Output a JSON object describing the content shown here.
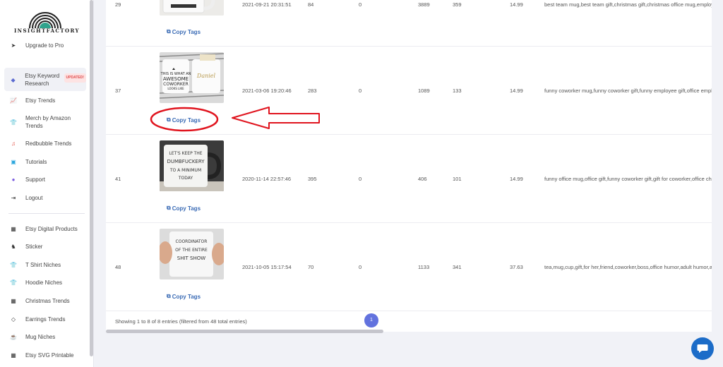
{
  "sidebar": {
    "logo_text": "INSIGHTFACTORY",
    "items": [
      {
        "label": "Upgrade to Pro",
        "icon": "paper-plane-icon",
        "glyph": "➤"
      },
      {
        "label": "Etsy Keyword Research",
        "badge": "UPDATED!",
        "icon": "tag-icon",
        "glyph": "◆"
      },
      {
        "label": "Etsy Trends",
        "icon": "line-chart-icon",
        "glyph": "📈"
      },
      {
        "label": "Merch by Amazon Trends",
        "icon": "tshirt-icon",
        "glyph": "👕"
      },
      {
        "label": "Redbubble Trends",
        "icon": "music-icon",
        "glyph": "♫"
      },
      {
        "label": "Tutorials",
        "icon": "tv-icon",
        "glyph": "▣"
      },
      {
        "label": "Support",
        "icon": "chat-icon",
        "glyph": "●"
      },
      {
        "label": "Logout",
        "icon": "logout-icon",
        "glyph": "⇥"
      },
      {
        "label": "Etsy Digital Products",
        "icon": "qr-icon",
        "glyph": "▦"
      },
      {
        "label": "Sticker",
        "icon": "horse-icon",
        "glyph": "♞"
      },
      {
        "label": "T Shirt Niches",
        "icon": "tshirt-icon",
        "glyph": "👕"
      },
      {
        "label": "Hoodie Niches",
        "icon": "hoodie-icon",
        "glyph": "👕"
      },
      {
        "label": "Christmas Trends",
        "icon": "qr-icon",
        "glyph": "▦"
      },
      {
        "label": "Earrings Trends",
        "icon": "diamond-icon",
        "glyph": "◇"
      },
      {
        "label": "Mug Niches",
        "icon": "mug-icon",
        "glyph": "☕"
      },
      {
        "label": "Etsy SVG Printable",
        "icon": "qr-icon",
        "glyph": "▦"
      }
    ]
  },
  "table": {
    "copy_label": "Copy Tags",
    "rows": [
      {
        "id": "29",
        "date": "2021-09-21 20:31:51",
        "c1": "84",
        "c2": "0",
        "c3": "3889",
        "c4": "359",
        "price": "14.99",
        "tags": "best team mug,best team gift,christmas gift,christmas office mug,employee gift,"
      },
      {
        "id": "37",
        "date": "2021-03-06 19:20:46",
        "c1": "283",
        "c2": "0",
        "c3": "1089",
        "c4": "133",
        "price": "14.99",
        "tags": "funny coworker mug,funny coworker gift,funny employee gift,office employee gift",
        "mug_text": "THIS IS WHAT AN AWESOME COWORKER LOOKS LIKE",
        "name_text": "Daniel"
      },
      {
        "id": "41",
        "date": "2020-11-14 22:57:46",
        "c1": "395",
        "c2": "0",
        "c3": "406",
        "c4": "101",
        "price": "14.99",
        "tags": "funny office mug,office gift,funny coworker gift,gift for coworker,office christmas",
        "mug_text": "LET'S KEEP THE DUMBFUCKERY TO A MINIMUM TODAY"
      },
      {
        "id": "48",
        "date": "2021-10-05 15:17:54",
        "c1": "70",
        "c2": "0",
        "c3": "1133",
        "c4": "341",
        "price": "37.63",
        "tags": "tea,mug,cup,gift,for her,friend,coworker,boss,office humor,adult humor,adult",
        "mug_text": "COORDINATOR OF THE ENTIRE SHIT SHOW"
      }
    ],
    "footer_text": "Showing 1 to 8 of 8 entries (filtered from 48 total entries)",
    "page": "1"
  },
  "colors": {
    "accent": "#6272de",
    "link": "#3a6bb5",
    "annotation": "#e0141e",
    "chat": "#1c6cc8"
  }
}
